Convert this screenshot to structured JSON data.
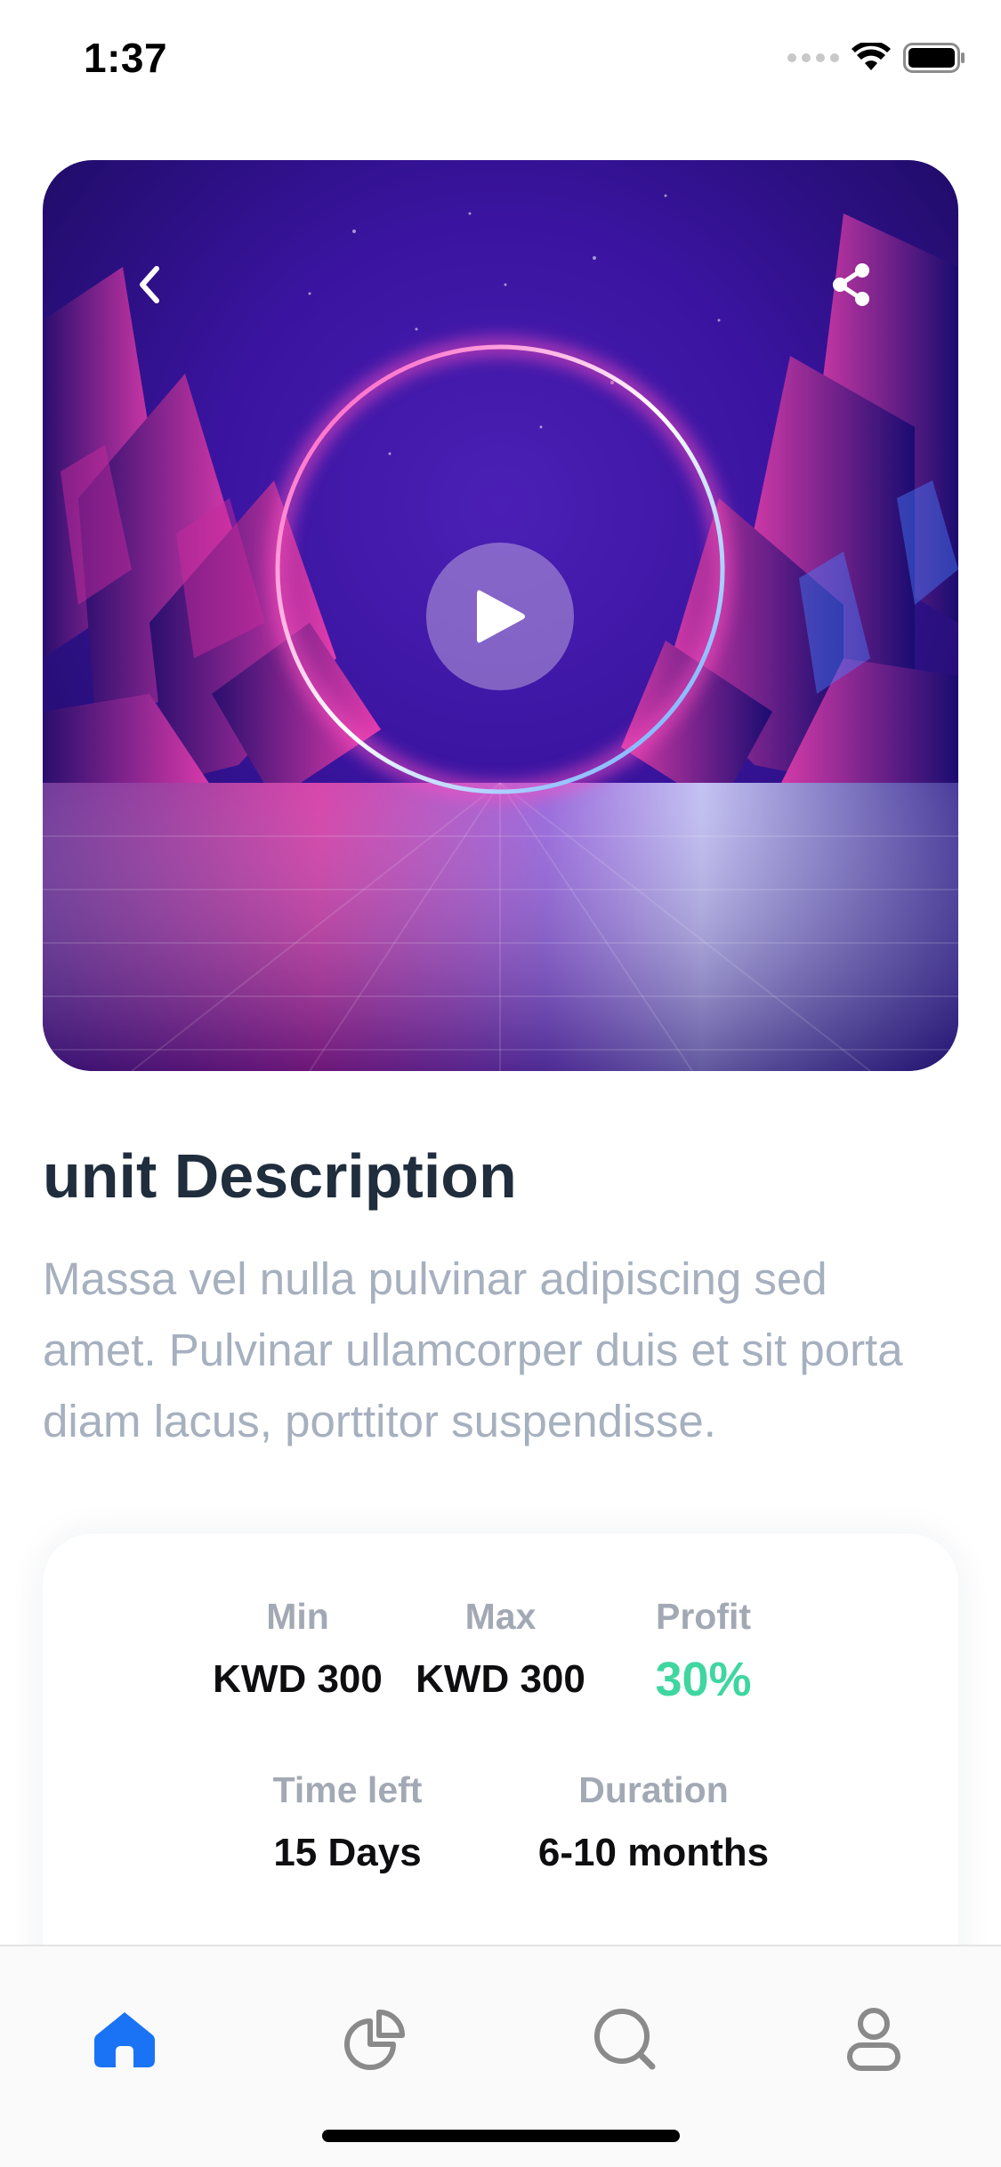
{
  "status_bar": {
    "time": "1:37"
  },
  "hero": {
    "icons": {
      "back": "chevron-left-icon",
      "share": "share-icon",
      "play": "play-icon"
    }
  },
  "description": {
    "title": "unit Description",
    "body": "Massa vel nulla pulvinar adipiscing sed amet. Pulvinar ullamcorper duis et sit porta diam lacus, porttitor suspendisse."
  },
  "info": {
    "min": {
      "label": "Min",
      "value": "KWD 300"
    },
    "max": {
      "label": "Max",
      "value": "KWD 300"
    },
    "profit": {
      "label": "Profit",
      "value": "30%"
    },
    "time_left": {
      "label": "Time left",
      "value": "15 Days"
    },
    "duration": {
      "label": "Duration",
      "value": "6-10 months"
    }
  },
  "nav": {
    "items": [
      {
        "icon": "home-icon",
        "active": true
      },
      {
        "icon": "pie-chart-icon",
        "active": false
      },
      {
        "icon": "search-icon",
        "active": false
      },
      {
        "icon": "profile-icon",
        "active": false
      }
    ]
  },
  "colors": {
    "title": "#1f2d3d",
    "body_text": "#a6b0bf",
    "label": "#a3a9b4",
    "value": "#0e0e10",
    "profit": "#3fd6a0",
    "nav_active": "#1a73f5",
    "nav_inactive": "#8a8a8a"
  }
}
